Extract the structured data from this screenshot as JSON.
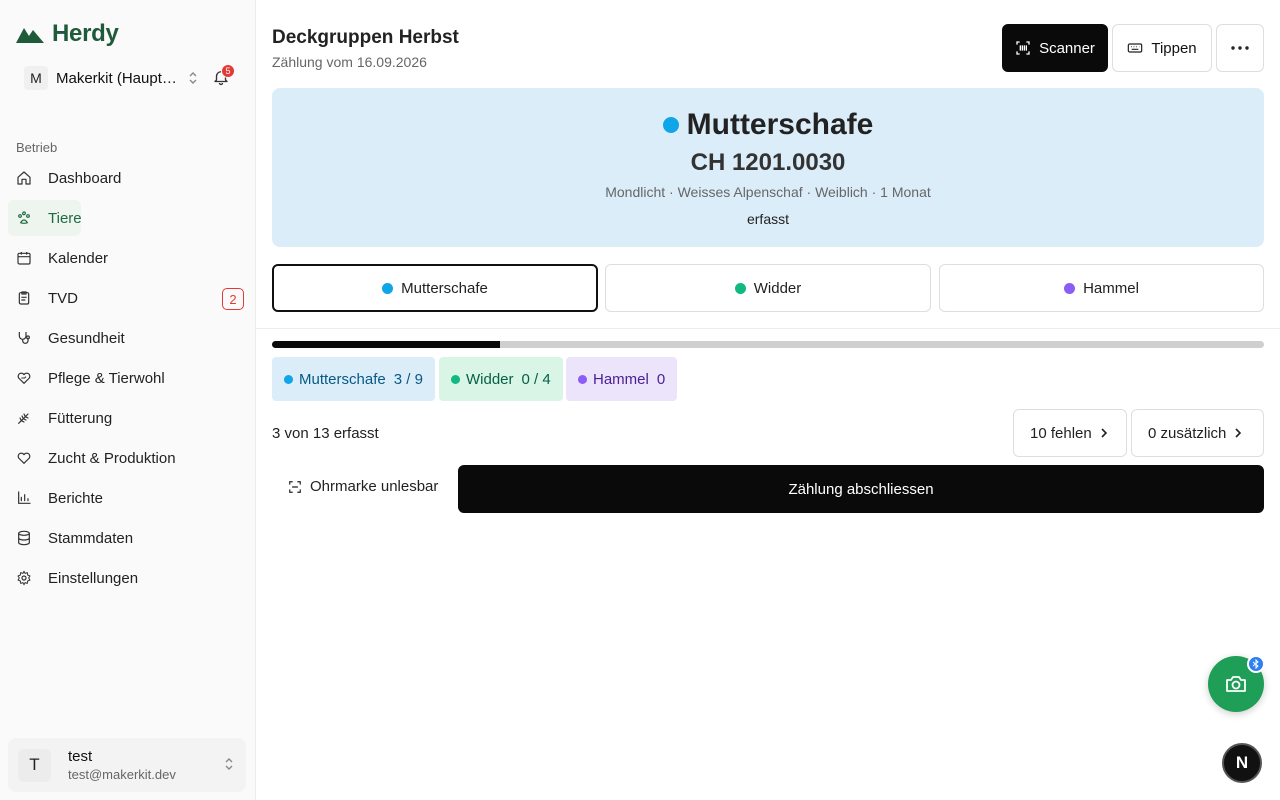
{
  "app": {
    "name": "Herdy"
  },
  "org": {
    "initial": "M",
    "name": "Makerkit (Hauptbetrieb)",
    "notifications": "5"
  },
  "sidebar": {
    "section": "Betrieb",
    "items": [
      {
        "label": "Dashboard",
        "icon": "home-icon"
      },
      {
        "label": "Tiere",
        "icon": "paw-icon",
        "active": true
      },
      {
        "label": "Kalender",
        "icon": "calendar-icon"
      },
      {
        "label": "TVD",
        "icon": "clipboard-icon",
        "badge": "2"
      },
      {
        "label": "Gesundheit",
        "icon": "stethoscope-icon"
      },
      {
        "label": "Pflege & Tierwohl",
        "icon": "heart-hand-icon"
      },
      {
        "label": "Fütterung",
        "icon": "wheat-icon"
      },
      {
        "label": "Zucht & Produktion",
        "icon": "heart-icon"
      },
      {
        "label": "Berichte",
        "icon": "bar-chart-icon"
      },
      {
        "label": "Stammdaten",
        "icon": "database-icon"
      },
      {
        "label": "Einstellungen",
        "icon": "gear-icon"
      }
    ]
  },
  "user": {
    "initial": "T",
    "name": "test",
    "email": "test@makerkit.dev"
  },
  "header": {
    "title": "Deckgruppen Herbst",
    "subtitle": "Zählung vom 16.09.2026",
    "scanner_label": "Scanner",
    "tippen_label": "Tippen"
  },
  "current": {
    "category": "Mutterschafe",
    "tag": "CH 1201.0030",
    "description": "Mondlicht · Weisses Alpenschaf · Weiblich · 1 Monat",
    "status": "erfasst"
  },
  "categories": [
    {
      "name": "Mutterschafe",
      "color": "#0ea5e9",
      "count": "3 / 9",
      "chip_bg": "#dcedfa",
      "chip_fg": "#075985"
    },
    {
      "name": "Widder",
      "color": "#10b981",
      "count": "0 / 4",
      "chip_bg": "#d8f5e6",
      "chip_fg": "#065f46"
    },
    {
      "name": "Hammel",
      "color": "#8b5cf6",
      "count": "0",
      "chip_bg": "#ebe4fb",
      "chip_fg": "#4c1d95"
    }
  ],
  "progress": {
    "fraction": 0.23
  },
  "summary": "3 von 13 erfasst",
  "missing_label": "10 fehlen",
  "extra_label": "0 zusätzlich",
  "unreadable_label": "Ohrmarke unlesbar",
  "finish_label": "Zählung abschliessen",
  "assistant": {
    "letter": "N"
  },
  "colors": {
    "brand": "#1f5a3a",
    "accent": "#1e9e57",
    "primary": "#0a0a0a"
  }
}
